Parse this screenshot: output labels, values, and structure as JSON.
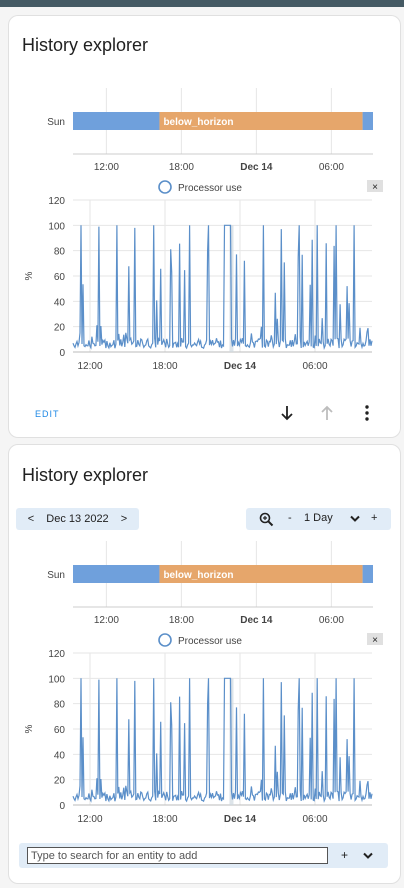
{
  "card1": {
    "title": "History explorer"
  },
  "card2": {
    "title": "History explorer"
  },
  "actions": {
    "edit_label": "EDIT",
    "download_icon": "arrow-down-icon",
    "upload_icon": "arrow-up-icon",
    "more_icon": "more-vert-icon"
  },
  "toolbar": {
    "prev": "<",
    "date": "Dec 13 2022",
    "next": ">",
    "zoom_icon": "zoom-in-icon",
    "minus": "-",
    "range": "1 Day",
    "plus": "+"
  },
  "search": {
    "placeholder": "Type to search for an entity to add",
    "add_label": "+"
  },
  "colors": {
    "below_horizon": "#e6a66b",
    "above_horizon": "#6fa0dc",
    "series": "#5b8fc9",
    "accent": "#1e88e5"
  },
  "chart_data": [
    {
      "type": "timeline",
      "row_label": "Sun",
      "segments": [
        {
          "state": "",
          "start": "Dec 13 09:20",
          "end": "Dec 13 16:15"
        },
        {
          "state": "below_horizon",
          "start": "Dec 13 16:15",
          "end": "Dec 14 08:30"
        },
        {
          "state": "",
          "start": "Dec 14 08:30",
          "end": "Dec 14 09:20"
        }
      ],
      "x_ticks": [
        {
          "label": "12:00",
          "t": 2.67,
          "bold": false
        },
        {
          "label": "18:00",
          "t": 8.67,
          "bold": false
        },
        {
          "label": "Dec 14",
          "t": 14.67,
          "bold": true
        },
        {
          "label": "06:00",
          "t": 20.67,
          "bold": false
        }
      ]
    },
    {
      "type": "line",
      "legend": "Processor use",
      "ylabel": "%",
      "ylim": [
        0,
        120
      ],
      "yticks": [
        0,
        20,
        40,
        60,
        80,
        100,
        120
      ],
      "x_ticks": [
        "12:00",
        "18:00",
        "Dec 14",
        "06:00"
      ],
      "grid": true,
      "series": [
        {
          "name": "Processor use",
          "baseline": 7,
          "spikes": [
            100,
            99,
            100,
            98,
            100,
            63,
            100,
            100,
            100,
            72,
            100,
            97,
            100,
            100,
            100,
            100
          ]
        }
      ]
    }
  ]
}
